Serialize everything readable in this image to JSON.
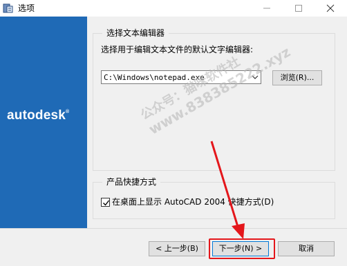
{
  "window": {
    "title": "选项",
    "icon": "app-options-icon"
  },
  "sidebar": {
    "logo_text": "autodesk",
    "logo_mark": "®",
    "color": "#1f6ab6"
  },
  "editor_group": {
    "title": "选择文本编辑器",
    "description": "选择用于编辑文本文件的默认文字编辑器:",
    "combo_value": "C:\\Windows\\notepad.exe",
    "browse_label": "浏览(R)..."
  },
  "shortcut_group": {
    "title": "产品快捷方式",
    "checkbox_label": "在桌面上显示 AutoCAD 2004 快捷方式(D)",
    "checked": true
  },
  "footer": {
    "back_label": "< 上一步(B)",
    "next_label": "下一步(N) >",
    "cancel_label": "取消"
  },
  "watermark": {
    "line1": "公众号：猫咪软件社",
    "line2": "www.838385222.xyz"
  },
  "colors": {
    "annotation": "#e4161b",
    "accent": "#0078d7"
  }
}
